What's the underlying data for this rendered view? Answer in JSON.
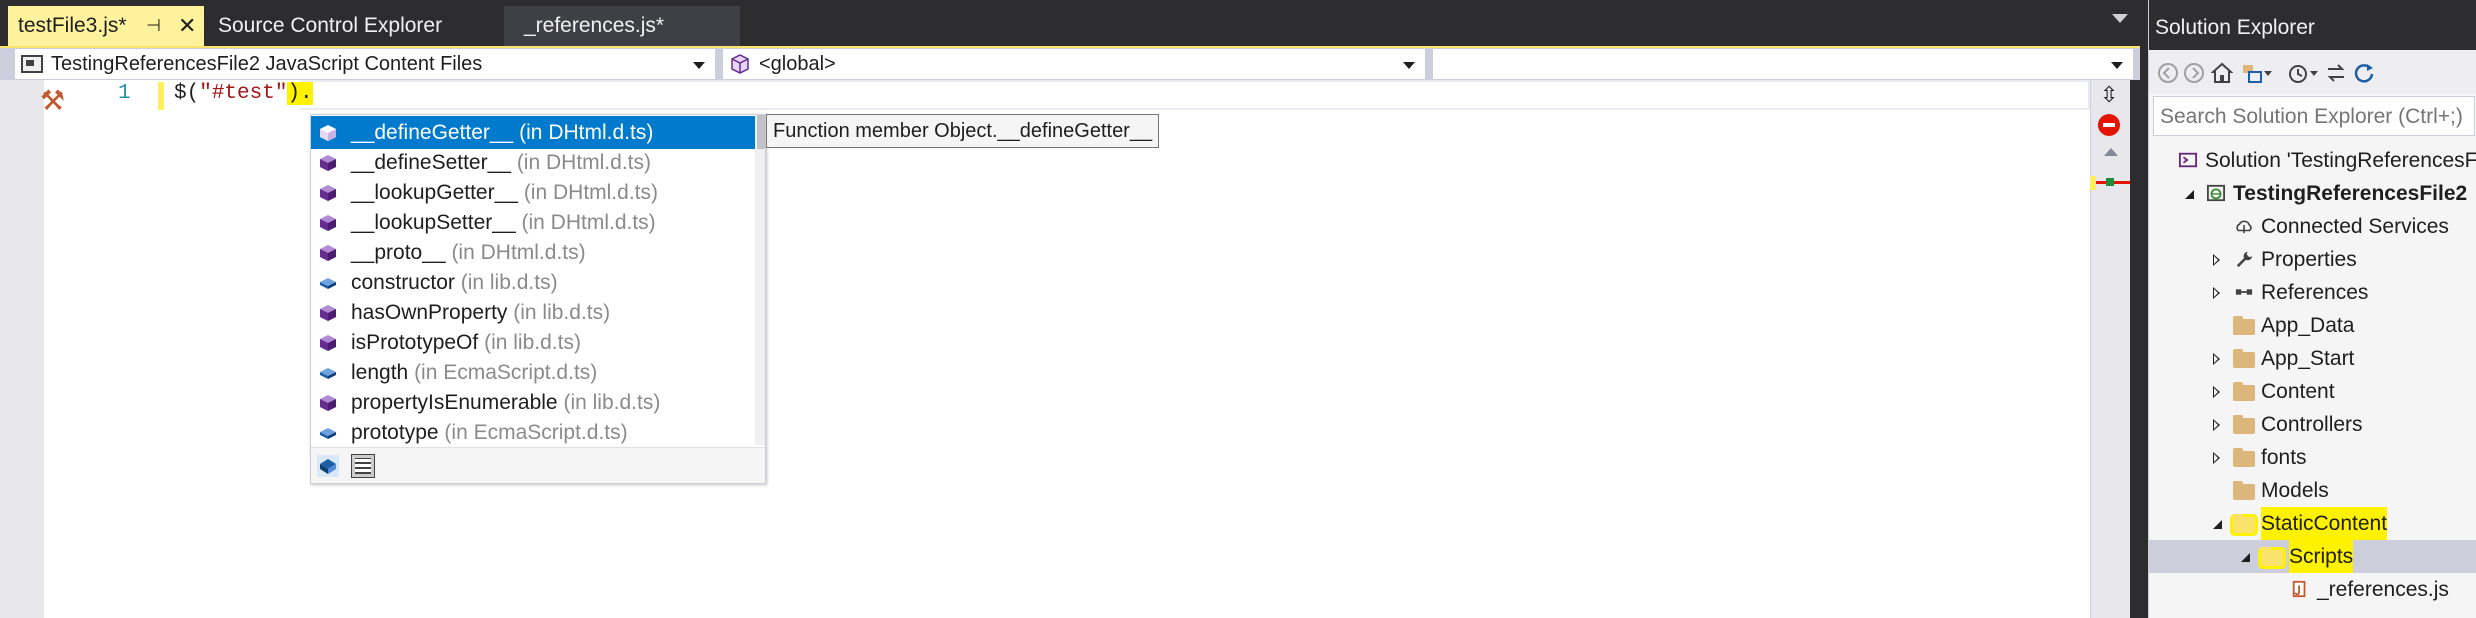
{
  "tabs": [
    {
      "label": "testFile3.js*",
      "active": true,
      "pinned": true
    },
    {
      "label": "Source Control Explorer",
      "active": false
    },
    {
      "label": "_references.js*",
      "active": false
    }
  ],
  "navigation_bar": {
    "project": "TestingReferencesFile2 JavaScript Content Files",
    "scope": "<global>",
    "member": ""
  },
  "editor": {
    "line_number": "1",
    "code_prefix": "$(",
    "code_string": "\"#test\"",
    "code_highlight": ").",
    "colors": {
      "string": "#a31515",
      "line_number": "#2b91af",
      "highlight": "#fff200"
    }
  },
  "completion_list": {
    "items": [
      {
        "name": "__defineGetter__",
        "source": "(in DHtml.d.ts)",
        "icon": "method-icon",
        "selected": true
      },
      {
        "name": "__defineSetter__",
        "source": "(in DHtml.d.ts)",
        "icon": "method-icon"
      },
      {
        "name": "__lookupGetter__",
        "source": "(in DHtml.d.ts)",
        "icon": "method-icon"
      },
      {
        "name": "__lookupSetter__",
        "source": "(in DHtml.d.ts)",
        "icon": "method-icon"
      },
      {
        "name": "__proto__",
        "source": "(in DHtml.d.ts)",
        "icon": "method-icon"
      },
      {
        "name": "constructor",
        "source": "(in lib.d.ts)",
        "icon": "field-icon"
      },
      {
        "name": "hasOwnProperty",
        "source": "(in lib.d.ts)",
        "icon": "method-icon"
      },
      {
        "name": "isPrototypeOf",
        "source": "(in lib.d.ts)",
        "icon": "method-icon"
      },
      {
        "name": "length",
        "source": "(in EcmaScript.d.ts)",
        "icon": "field-icon"
      },
      {
        "name": "propertyIsEnumerable",
        "source": "(in lib.d.ts)",
        "icon": "method-icon"
      },
      {
        "name": "prototype",
        "source": "(in EcmaScript.d.ts)",
        "icon": "field-icon"
      }
    ],
    "footer_filters": [
      "member-filter-icon",
      "keyword-filter-icon"
    ],
    "tooltip": "Function member Object.__defineGetter__",
    "colors": {
      "selected_bg": "#007acc",
      "method_icon": "#652d90",
      "field_icon": "#1d5fa6"
    }
  },
  "solution_explorer": {
    "title": "Solution Explorer",
    "search_placeholder": "Search Solution Explorer (Ctrl+;)",
    "tree": [
      {
        "label": "Solution 'TestingReferencesFi",
        "icon": "solution-icon",
        "depth": 0,
        "expander": "none"
      },
      {
        "label": "TestingReferencesFile2",
        "icon": "web-project-icon",
        "depth": 1,
        "expander": "expanded",
        "bold": true
      },
      {
        "label": "Connected Services",
        "icon": "cloud-icon",
        "depth": 2,
        "expander": "none"
      },
      {
        "label": "Properties",
        "icon": "wrench-icon",
        "depth": 2,
        "expander": "collapsed"
      },
      {
        "label": "References",
        "icon": "references-icon",
        "depth": 2,
        "expander": "collapsed"
      },
      {
        "label": "App_Data",
        "icon": "folder-icon",
        "depth": 2,
        "expander": "none"
      },
      {
        "label": "App_Start",
        "icon": "folder-icon",
        "depth": 2,
        "expander": "collapsed"
      },
      {
        "label": "Content",
        "icon": "folder-icon",
        "depth": 2,
        "expander": "collapsed"
      },
      {
        "label": "Controllers",
        "icon": "folder-icon",
        "depth": 2,
        "expander": "collapsed"
      },
      {
        "label": "fonts",
        "icon": "folder-icon",
        "depth": 2,
        "expander": "collapsed"
      },
      {
        "label": "Models",
        "icon": "folder-icon",
        "depth": 2,
        "expander": "none"
      },
      {
        "label": "StaticContent",
        "icon": "folder-icon",
        "depth": 2,
        "expander": "expanded",
        "highlighted": true
      },
      {
        "label": "Scripts",
        "icon": "folder-icon",
        "depth": 3,
        "expander": "expanded",
        "highlighted": true,
        "selected": true
      },
      {
        "label": "_references.js",
        "icon": "js-references-icon",
        "depth": 4,
        "expander": "none"
      }
    ]
  }
}
